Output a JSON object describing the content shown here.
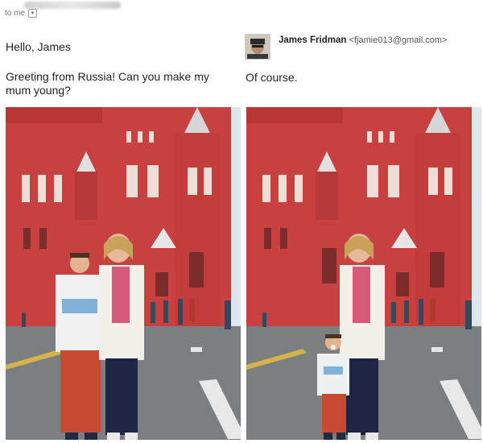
{
  "header": {
    "to_label": "to me",
    "dropdown_icon": "chevron-down-icon"
  },
  "left_message": {
    "greeting": "Hello, James",
    "body_line1": "Greeting from Russia! Can you make my",
    "body_line2": "mum young?"
  },
  "right_message": {
    "sender_name": "James Fridman",
    "sender_email": "<fjamie013@gmail.com>",
    "avatar_icon": "avatar",
    "body": "Of course."
  },
  "colors": {
    "building_red": "#c8403f",
    "sky": "#dfe7ee",
    "pavement": "#7c7f82"
  }
}
